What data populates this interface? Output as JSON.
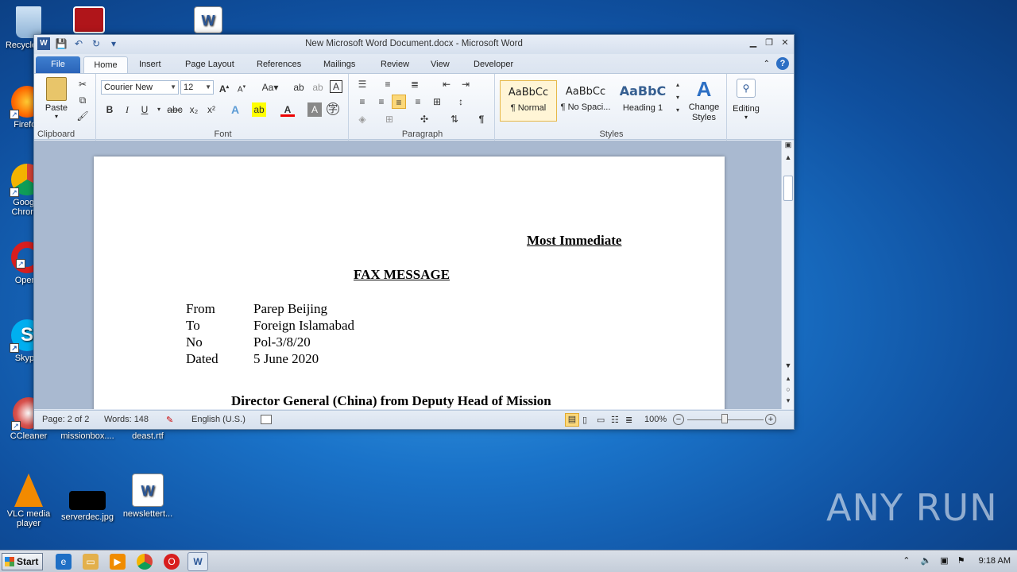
{
  "desktop": {
    "icons": [
      {
        "label": "Recycle Bin",
        "icon": "recycle-bin-icon"
      },
      {
        "label": "Firefox",
        "icon": "firefox-icon"
      },
      {
        "label": "Google Chrome",
        "icon": "chrome-icon"
      },
      {
        "label": "Opera",
        "icon": "opera-icon"
      },
      {
        "label": "Skype",
        "icon": "skype-icon"
      },
      {
        "label": "CCleaner",
        "icon": "ccleaner-icon"
      },
      {
        "label": "missionbox....",
        "icon": "file-icon"
      },
      {
        "label": "deast.rtf",
        "icon": "rtf-icon"
      },
      {
        "label": "VLC media player",
        "icon": "vlc-icon"
      },
      {
        "label": "serverdec.jpg",
        "icon": "image-icon"
      },
      {
        "label": "newslettert...",
        "icon": "word-doc-icon"
      }
    ],
    "watermark": "ANY RUN"
  },
  "word": {
    "title": "New Microsoft Word Document.docx  -  Microsoft Word",
    "tabs": [
      "File",
      "Home",
      "Insert",
      "Page Layout",
      "References",
      "Mailings",
      "Review",
      "View",
      "Developer"
    ],
    "ribbon": {
      "clipboard": {
        "label": "Clipboard",
        "paste": "Paste"
      },
      "font": {
        "label": "Font",
        "name": "Courier New",
        "size": "12"
      },
      "paragraph": {
        "label": "Paragraph"
      },
      "styles": {
        "label": "Styles",
        "items": [
          {
            "preview": "AaBbCc",
            "name": "¶ Normal"
          },
          {
            "preview": "AaBbCc",
            "name": "¶ No Spaci..."
          },
          {
            "preview": "AaBbC",
            "name": "Heading 1"
          }
        ],
        "change_styles": "Change Styles"
      },
      "editing": {
        "label": "Editing"
      }
    },
    "document": {
      "priority": "Most Immediate",
      "heading": "FAX MESSAGE",
      "fields": [
        {
          "key": "From",
          "value": "Parep Beijing"
        },
        {
          "key": "To",
          "value": "Foreign Islamabad"
        },
        {
          "key": "No",
          "value": "Pol-3/8/20"
        },
        {
          "key": "Dated",
          "value": "5 June 2020"
        }
      ],
      "subject": "Director General (China) from Deputy Head of Mission"
    },
    "status": {
      "page": "Page: 2 of 2",
      "words": "Words: 148",
      "language": "English (U.S.)",
      "zoom": "100%"
    }
  },
  "taskbar": {
    "start": "Start",
    "time": "9:18 AM"
  }
}
